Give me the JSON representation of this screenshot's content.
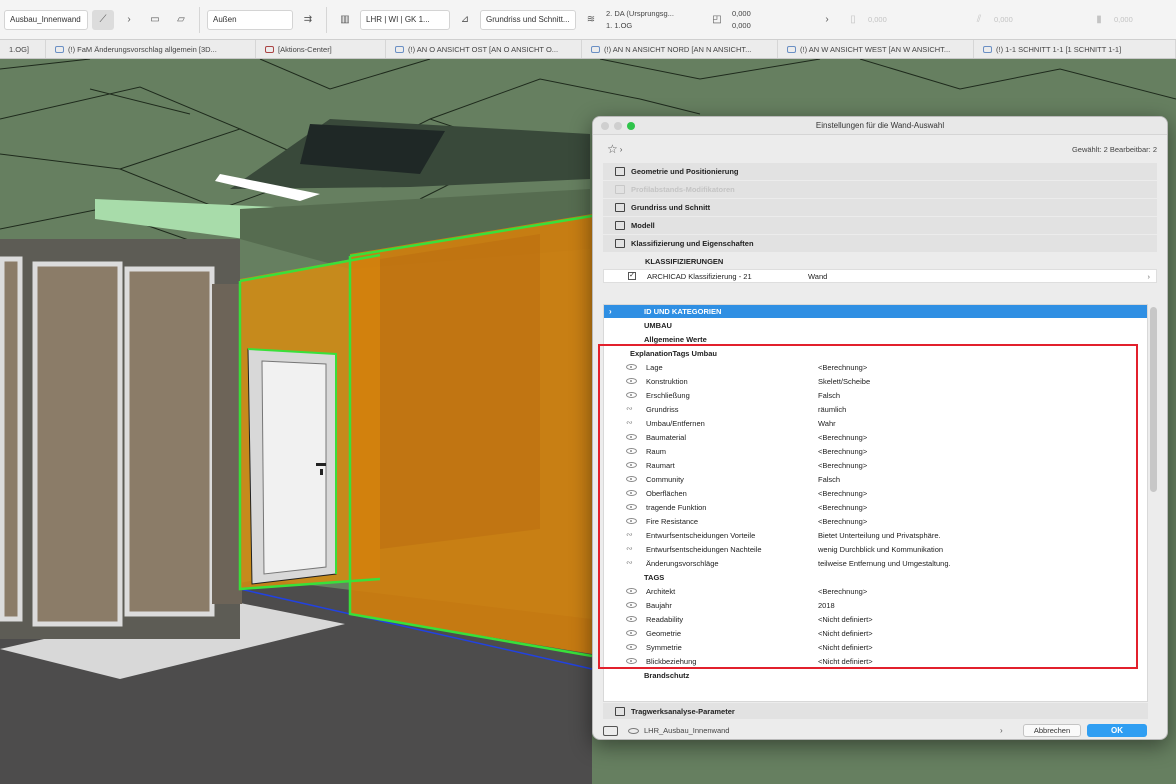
{
  "toolbar": {
    "layer_name": "Ausbau_Innenwand",
    "reference_line": "Außen",
    "composite": "LHR | WI | GK 1...",
    "view_mode": "Grundriss und Schnitt...",
    "top_story": "2. DA (Ursprungsg...",
    "home_story": "1. 1.OG",
    "offset_top": "0,000",
    "offset_bottom": "0,000",
    "dim_field_1": "0,000",
    "dim_field_2": "0,000",
    "dim_field_3": "0,000"
  },
  "tabs": [
    {
      "label": "1.OG]"
    },
    {
      "label": "(!) FaM Änderungsvorschlag allgemein [3D..."
    },
    {
      "label": "[Aktions-Center]"
    },
    {
      "label": "(!) AN O ANSICHT OST [AN O ANSICHT O..."
    },
    {
      "label": "(!) AN N ANSICHT NORD [AN N ANSICHT..."
    },
    {
      "label": "(!) AN W ANSICHT WEST [AN W ANSICHT..."
    },
    {
      "label": "(!) 1-1 SCHNITT 1-1 [1 SCHNITT 1-1]"
    }
  ],
  "dialog": {
    "title": "Einstellungen für die Wand-Auswahl",
    "selection_info": "Gewählt: 2 Bearbeitbar: 2",
    "panels": [
      {
        "label": "Geometrie und Positionierung",
        "disabled": false
      },
      {
        "label": "Profilabstands-Modifikatoren",
        "disabled": true
      },
      {
        "label": "Grundriss und Schnitt",
        "disabled": false
      },
      {
        "label": "Modell",
        "disabled": false
      },
      {
        "label": "Klassifizierung und Eigenschaften",
        "disabled": false
      }
    ],
    "classification_header": "KLASSIFIZIERUNGEN",
    "classification_row": {
      "system": "ARCHICAD Klassifizierung - 21",
      "value": "Wand"
    },
    "sections": {
      "id_kategorien": "ID UND KATEGORIEN",
      "umbau": "UMBAU",
      "allgemeine_werte": "Allgemeine Werte",
      "explanation_tags": "ExplanationTags Umbau",
      "tags": "TAGS",
      "brandschutz": "Brandschutz"
    },
    "explanation_props": [
      {
        "name": "Lage",
        "value": "<Berechnung>",
        "icon": "eye"
      },
      {
        "name": "Konstruktion",
        "value": "Skelett/Scheibe",
        "icon": "eye"
      },
      {
        "name": "Erschließung",
        "value": "Falsch",
        "icon": "eye"
      },
      {
        "name": "Grundriss",
        "value": "räumlich",
        "icon": "link"
      },
      {
        "name": "Umbau/Entfernen",
        "value": "Wahr",
        "icon": "link"
      },
      {
        "name": "Baumaterial",
        "value": "<Berechnung>",
        "icon": "eye"
      },
      {
        "name": "Raum",
        "value": "<Berechnung>",
        "icon": "eye"
      },
      {
        "name": "Raumart",
        "value": "<Berechnung>",
        "icon": "eye"
      },
      {
        "name": "Community",
        "value": "Falsch",
        "icon": "eye"
      },
      {
        "name": "Oberflächen",
        "value": "<Berechnung>",
        "icon": "eye"
      },
      {
        "name": "tragende Funktion",
        "value": "<Berechnung>",
        "icon": "eye"
      },
      {
        "name": "Fire Resistance",
        "value": "<Berechnung>",
        "icon": "eye"
      },
      {
        "name": "Entwurfsentscheidungen Vorteile",
        "value": "Bietet Unterteilung und Privatsphäre.",
        "icon": "link"
      },
      {
        "name": "Entwurfsentscheidungen Nachteile",
        "value": "wenig Durchblick und Kommunikation",
        "icon": "link"
      },
      {
        "name": "Änderungsvorschläge",
        "value": "teilweise Entfernung und Umgestaltung.",
        "icon": "link"
      }
    ],
    "tag_props": [
      {
        "name": "Architekt",
        "value": "<Berechnung>",
        "icon": "eye"
      },
      {
        "name": "Baujahr",
        "value": "2018",
        "icon": "eye"
      },
      {
        "name": "Readability",
        "value": "<Nicht definiert>",
        "icon": "eye"
      },
      {
        "name": "Geometrie",
        "value": "<Nicht definiert>",
        "icon": "eye"
      },
      {
        "name": "Symmetrie",
        "value": "<Nicht definiert>",
        "icon": "eye"
      },
      {
        "name": "Blickbeziehung",
        "value": "<Nicht definiert>",
        "icon": "eye"
      }
    ],
    "bottom_panel": "Tragwerksanalyse-Parameter",
    "footer": {
      "layer": "LHR_Ausbau_Innenwand",
      "cancel_label": "Abbrechen",
      "ok_label": "OK"
    }
  },
  "colors": {
    "accent": "#2f8fe3",
    "ok_button": "#2f9ef2",
    "highlight": "#e2202c",
    "selection_green": "#39e03a",
    "ceiling_green": "#6c8a67",
    "orange_wall": "#d9880f"
  }
}
